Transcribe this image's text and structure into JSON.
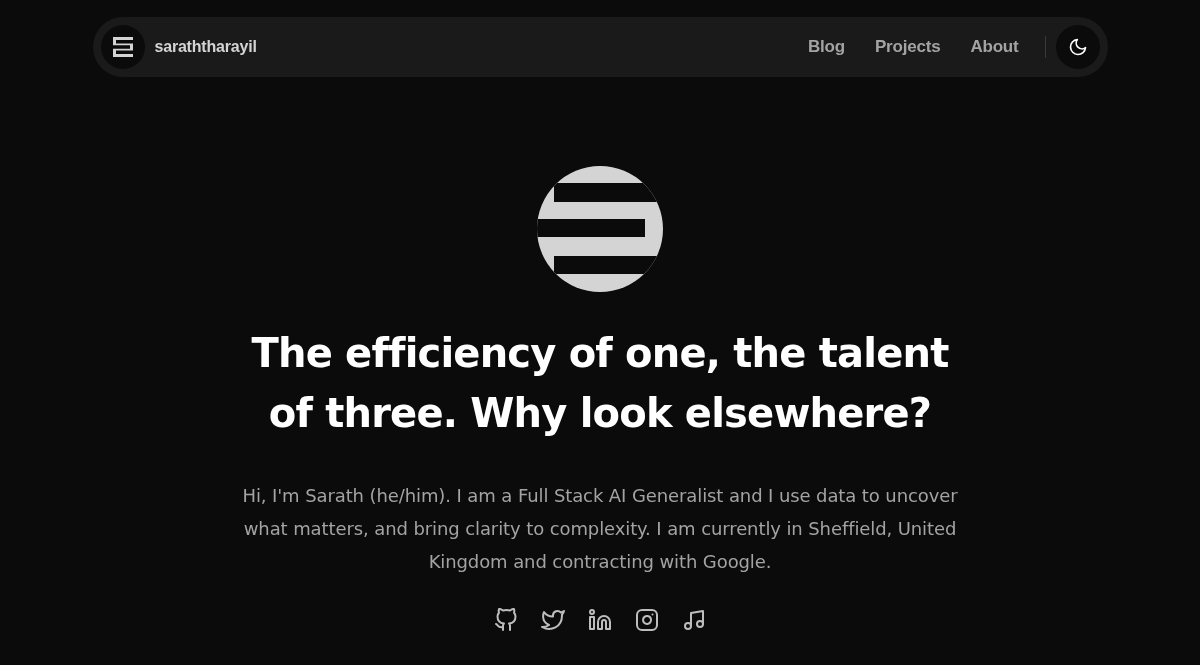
{
  "nav": {
    "brand": "saraththarayil",
    "links": [
      "Blog",
      "Projects",
      "About"
    ]
  },
  "hero": {
    "headline": "The efficiency of one, the talent of three. Why look elsewhere?",
    "intro": "Hi, I'm Sarath (he/him). I am a Full Stack AI Generalist and I use data to uncover what matters, and bring clarity to complexity. I am currently in Sheffield, United Kingdom and contracting with Google.",
    "social_links": [
      {
        "kind": "github"
      },
      {
        "kind": "twitter"
      },
      {
        "kind": "linkedin"
      },
      {
        "kind": "instagram"
      },
      {
        "kind": "music"
      }
    ]
  }
}
